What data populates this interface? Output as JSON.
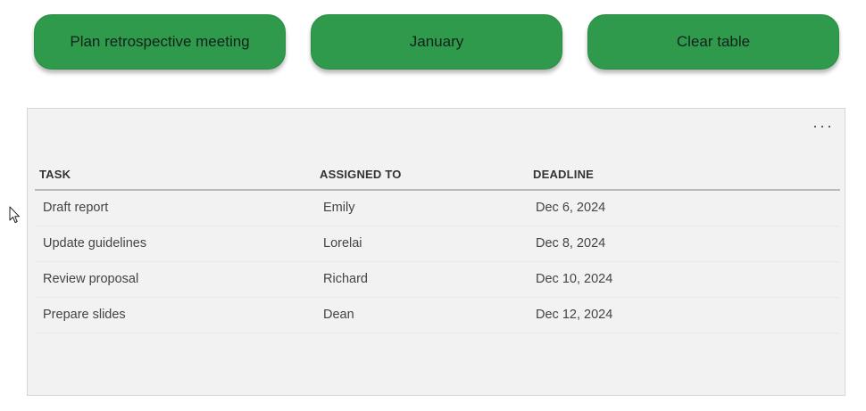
{
  "buttons": {
    "plan": "Plan retrospective meeting",
    "month": "January",
    "clear": "Clear table"
  },
  "table": {
    "more_icon": "more-horizontal-icon",
    "more_label": "···",
    "headers": {
      "task": "TASK",
      "assigned": "ASSIGNED TO",
      "deadline": "DEADLINE"
    },
    "rows": [
      {
        "task": "Draft report",
        "assigned": "Emily",
        "deadline": "Dec 6, 2024"
      },
      {
        "task": "Update guidelines",
        "assigned": "Lorelai",
        "deadline": "Dec 8, 2024"
      },
      {
        "task": "Review proposal",
        "assigned": "Richard",
        "deadline": "Dec 10, 2024"
      },
      {
        "task": "Prepare slides",
        "assigned": "Dean",
        "deadline": "Dec 12, 2024"
      }
    ]
  },
  "colors": {
    "button_green": "#2f9a4b",
    "panel_bg": "#f2f2f2"
  },
  "cursor_icon": "mouse-pointer-icon"
}
